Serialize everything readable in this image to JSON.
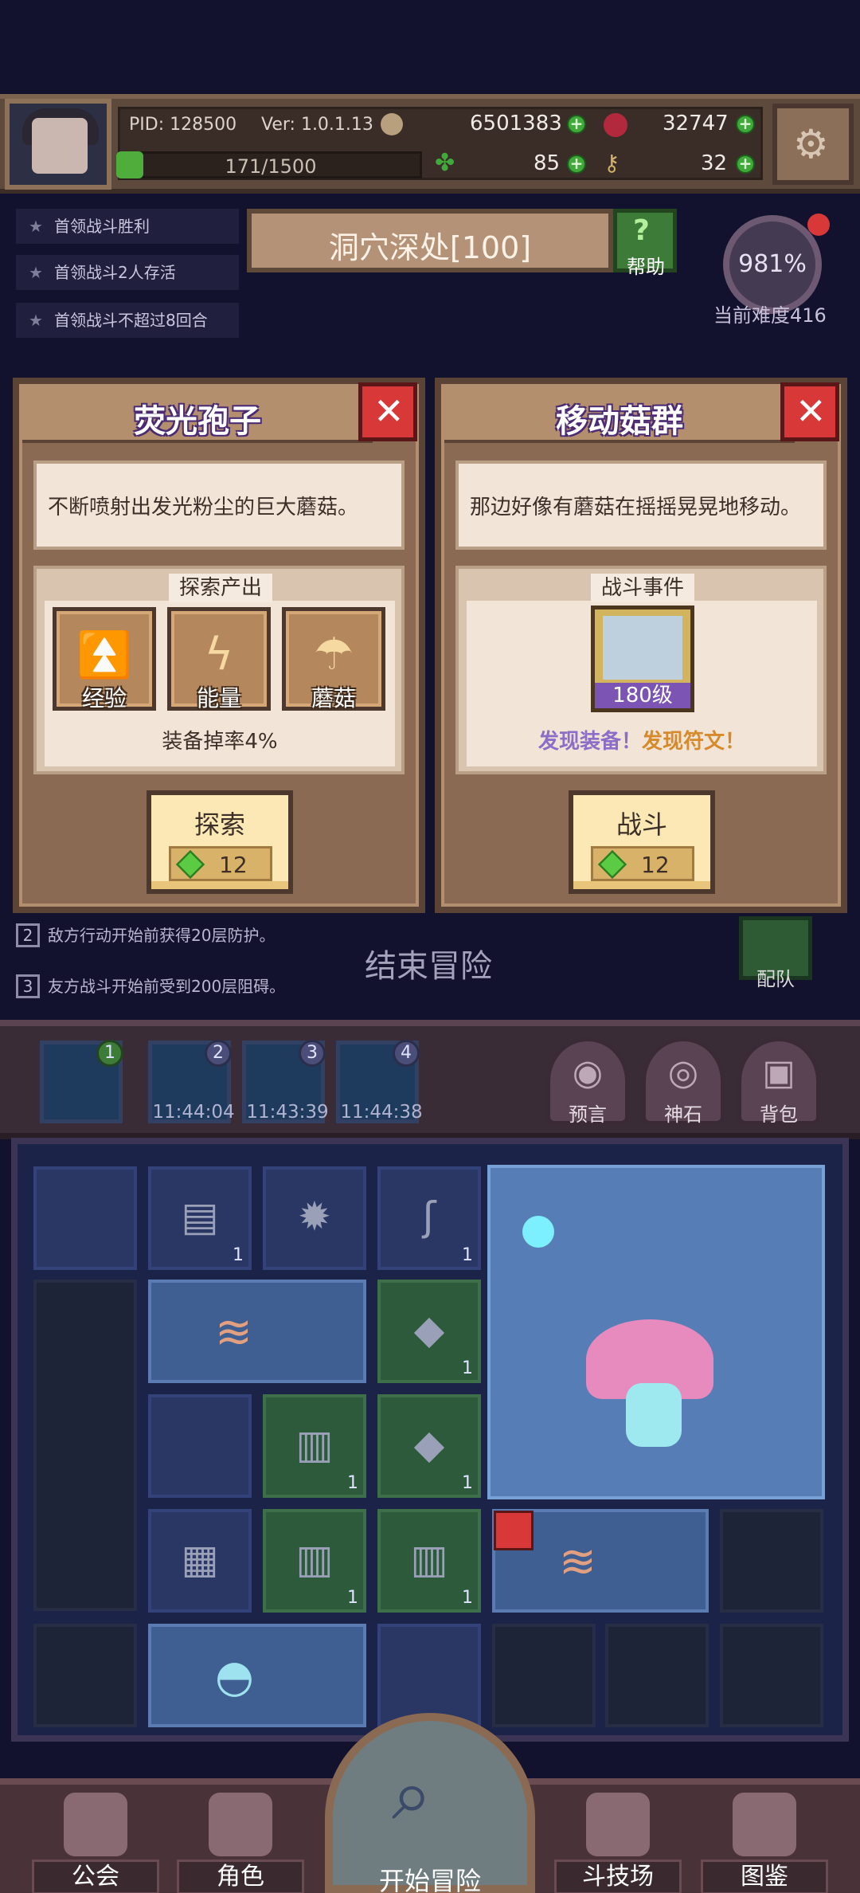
{
  "header": {
    "pid": "PID: 128500",
    "version": "Ver: 1.0.1.13",
    "energy": "171/1500",
    "gold": "6501383",
    "ruby": "32747",
    "clover": "85",
    "keys": "32"
  },
  "quests": [
    "首领战斗胜利",
    "首领战斗2人存活",
    "首领战斗不超过8回合"
  ],
  "stage": {
    "title": "洞穴深处[100]",
    "help_label": "帮助",
    "difficulty_percent": "981%",
    "difficulty_label": "当前难度416"
  },
  "card_left": {
    "title": "荧光孢子",
    "description": "不断喷射出发光粉尘的巨大蘑菇。",
    "section": "探索产出",
    "rewards": [
      {
        "icon": "arrow-up-icon",
        "label": "经验"
      },
      {
        "icon": "lightning-icon",
        "label": "能量"
      },
      {
        "icon": "mushroom-icon",
        "label": "蘑菇"
      }
    ],
    "drop_rate": "装备掉率4%",
    "action_label": "探索",
    "action_cost": "12"
  },
  "card_right": {
    "title": "移动菇群",
    "description": "那边好像有蘑菇在摇摇晃晃地移动。",
    "section": "战斗事件",
    "enemy_level": "180级",
    "find_gear": "发现装备！",
    "find_rune": "发现符文！",
    "action_label": "战斗",
    "action_cost": "12"
  },
  "rules": [
    {
      "num": "2",
      "text": "敌方行动开始前获得20层防护。"
    },
    {
      "num": "3",
      "text": "友方战斗开始前受到200层阻碍。"
    }
  ],
  "end_label": "结束冒险",
  "team_label": "配队",
  "slots": [
    {
      "badge": "1",
      "time": ""
    },
    {
      "badge": "2",
      "time": "11:44:04"
    },
    {
      "badge": "3",
      "time": "11:43:39"
    },
    {
      "badge": "4",
      "time": "11:44:38"
    }
  ],
  "side_buttons": [
    "预言",
    "神石",
    "背包"
  ],
  "inventory_counts": [
    "1",
    "1",
    "1",
    "1",
    "1",
    "1",
    "1"
  ],
  "nav": {
    "guild": "公会",
    "character": "角色",
    "start": "开始冒险",
    "arena": "斗技场",
    "codex": "图鉴"
  }
}
